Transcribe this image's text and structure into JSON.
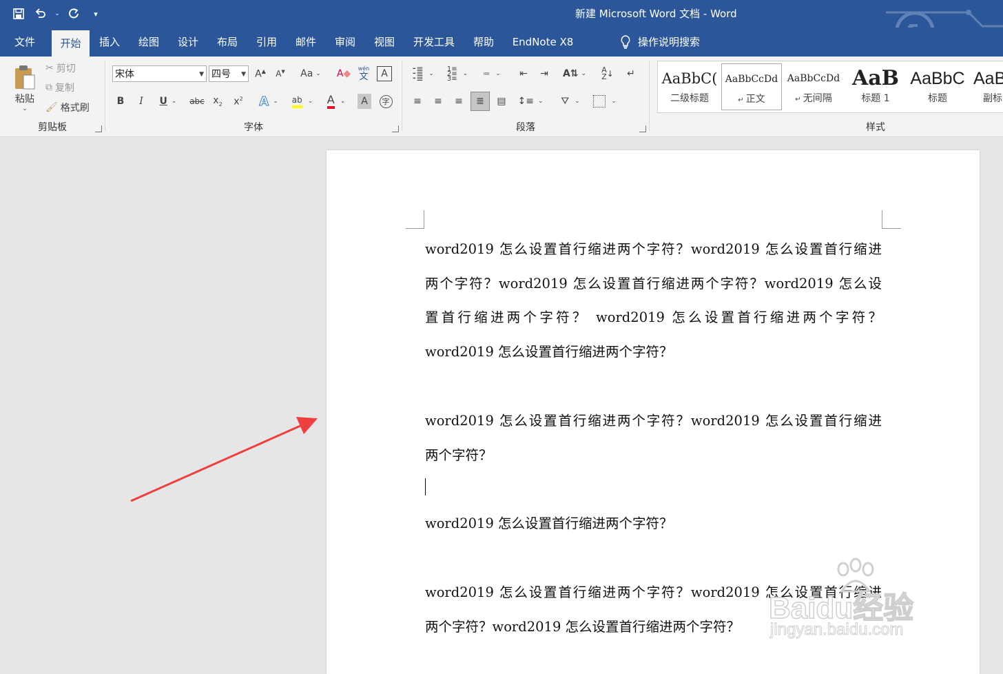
{
  "window": {
    "title": "新建 Microsoft Word 文档  -  Word"
  },
  "tabs": [
    {
      "label": "文件"
    },
    {
      "label": "开始"
    },
    {
      "label": "插入"
    },
    {
      "label": "绘图"
    },
    {
      "label": "设计"
    },
    {
      "label": "布局"
    },
    {
      "label": "引用"
    },
    {
      "label": "邮件"
    },
    {
      "label": "审阅"
    },
    {
      "label": "视图"
    },
    {
      "label": "开发工具"
    },
    {
      "label": "帮助"
    },
    {
      "label": "EndNote X8"
    }
  ],
  "active_tab": "开始",
  "search": {
    "label": "操作说明搜索"
  },
  "clipboard": {
    "paste": "粘贴",
    "cut": "剪切",
    "copy": "复制",
    "format_painter": "格式刷",
    "group": "剪贴板"
  },
  "font": {
    "name": "宋体",
    "size": "四号",
    "group": "字体",
    "case_label": "Aa",
    "phonetic_top": "wén",
    "phonetic_bottom": "文"
  },
  "paragraph": {
    "group": "段落"
  },
  "styles": {
    "group": "样式",
    "items": [
      {
        "preview": "AaBbC(",
        "name": "二级标题"
      },
      {
        "preview": "AaBbCcDd",
        "name": "正文"
      },
      {
        "preview": "AaBbCcDd",
        "name": "无间隔"
      },
      {
        "preview": "AaB",
        "name": "标题 1"
      },
      {
        "preview": "AaBbC",
        "name": "标题"
      },
      {
        "preview": "AaB",
        "name": "副标"
      }
    ]
  },
  "document": {
    "lines": [
      "word2019 怎么设置首行缩进两个字符？word2019 怎么设置首行缩进",
      "两个字符？word2019 怎么设置首行缩进两个字符？word2019 怎么设",
      "置首行缩进两个字符？ word2019  怎么设置首行缩进两个字符？",
      "word2019 怎么设置首行缩进两个字符？",
      "word2019 怎么设置首行缩进两个字符？word2019 怎么设置首行缩进",
      "两个字符？",
      "word2019 怎么设置首行缩进两个字符？",
      "word2019 怎么设置首行缩进两个字符？word2019 怎么设置首行缩进",
      "两个字符？word2019 怎么设置首行缩进两个字符？"
    ]
  },
  "watermark": {
    "brand": "Baidu经验",
    "url": "jingyan.baidu.com"
  },
  "colors": {
    "accent": "#2b579a",
    "arrow": "#ef3e3e",
    "highlight": "#ffff00",
    "font_color": "#e81123"
  }
}
